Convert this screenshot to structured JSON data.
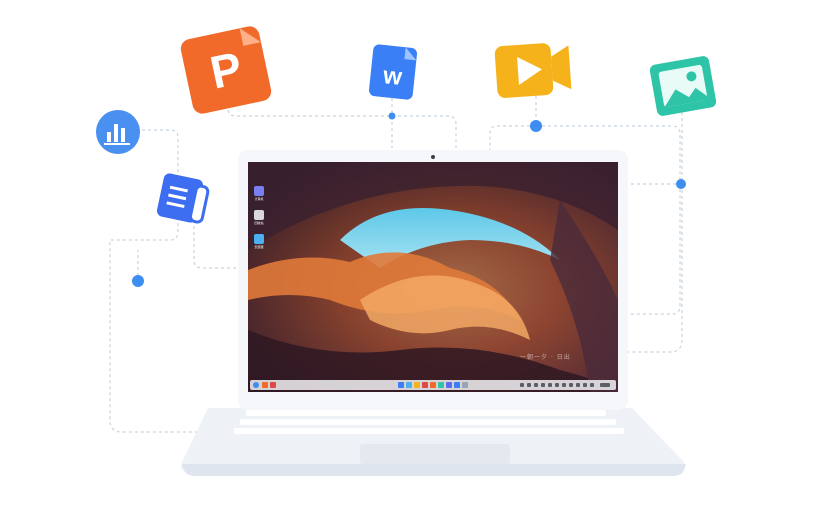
{
  "app_icons": {
    "presentation": {
      "icon": "presentation-icon",
      "letter": "P",
      "color": "#f26a2a"
    },
    "writer": {
      "icon": "writer-icon",
      "letter": "w",
      "color": "#3a7ff6"
    },
    "video": {
      "icon": "video-icon",
      "color": "#f6b21a"
    },
    "image": {
      "icon": "image-icon",
      "color": "#2ec4a8"
    },
    "chart": {
      "icon": "chart-icon",
      "color": "#4a90f0"
    },
    "notes": {
      "icon": "notes-icon",
      "color": "#3d6df0"
    }
  },
  "desktop": {
    "icons": [
      {
        "label": "计算机",
        "icon": "computer-icon"
      },
      {
        "label": "回收站",
        "icon": "trash-icon"
      },
      {
        "label": "安装器",
        "icon": "installer-icon"
      }
    ],
    "watermark": "一朝一夕 · 日出"
  },
  "colors": {
    "connector": "#c9d3e0",
    "dot": "#3d8ef0",
    "laptop": "#eef2f7",
    "bezel": "#f5f7fa"
  }
}
